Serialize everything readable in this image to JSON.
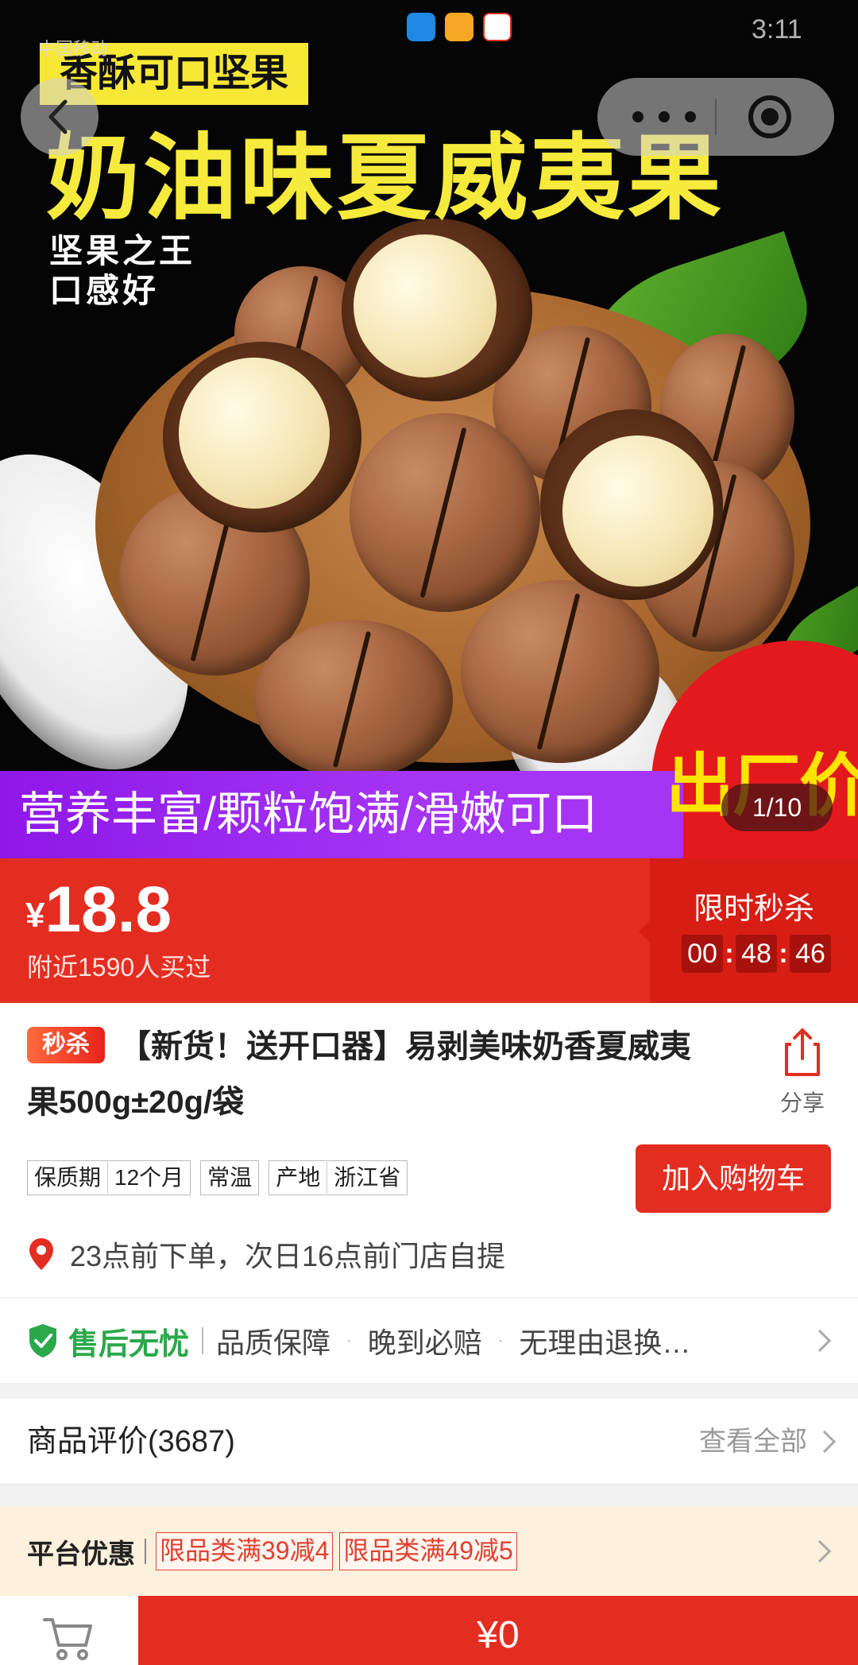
{
  "status_bar": {
    "carrier": "中国移动",
    "time": "3:11"
  },
  "hero": {
    "slogan": "香酥可口坚果",
    "title": "奶油味夏威夷果",
    "subtitle_line1": "坚果之王",
    "subtitle_line2": "口感好",
    "band_text": "营养丰富/颗粒饱满/滑嫩可口",
    "badge_text": "出厂价",
    "page_indicator": "1/10"
  },
  "nav": {
    "back_icon": "chevron-left-icon",
    "more_icon": "more-dots-icon",
    "close_icon": "target-icon"
  },
  "price": {
    "currency": "¥",
    "value": "18.8",
    "bought": "附近1590人买过",
    "flash_label": "限时秒杀",
    "countdown": {
      "h": "00",
      "m": "48",
      "s": "46"
    }
  },
  "product": {
    "tag": "秒杀",
    "title_line1": "【新货！送开口器】易剥美味奶香夏威夷",
    "title_line2": "果500g±20g/袋",
    "share_label": "分享",
    "attributes": [
      {
        "key": "保质期",
        "value": "12个月"
      },
      {
        "key": "常温",
        "value": ""
      },
      {
        "key": "产地",
        "value": "浙江省"
      }
    ],
    "add_cart_label": "加入购物车",
    "pickup_text": "23点前下单，次日16点前门店自提"
  },
  "after_sales": {
    "title": "售后无忧",
    "items": [
      "品质保障",
      "晚到必赔",
      "无理由退换…"
    ],
    "separator": "·"
  },
  "reviews": {
    "title": "商品评价(3687)",
    "more": "查看全部"
  },
  "coupons": {
    "title": "平台优惠",
    "items": [
      "限品类满39减4",
      "限品类满49减5"
    ]
  },
  "bottom": {
    "buy_amount": "¥0"
  },
  "colors": {
    "accent_red": "#e42d21",
    "flash_red": "#d81e14",
    "green": "#2aa84a",
    "purple": "#a534f5",
    "yellow": "#f6ea3c"
  }
}
